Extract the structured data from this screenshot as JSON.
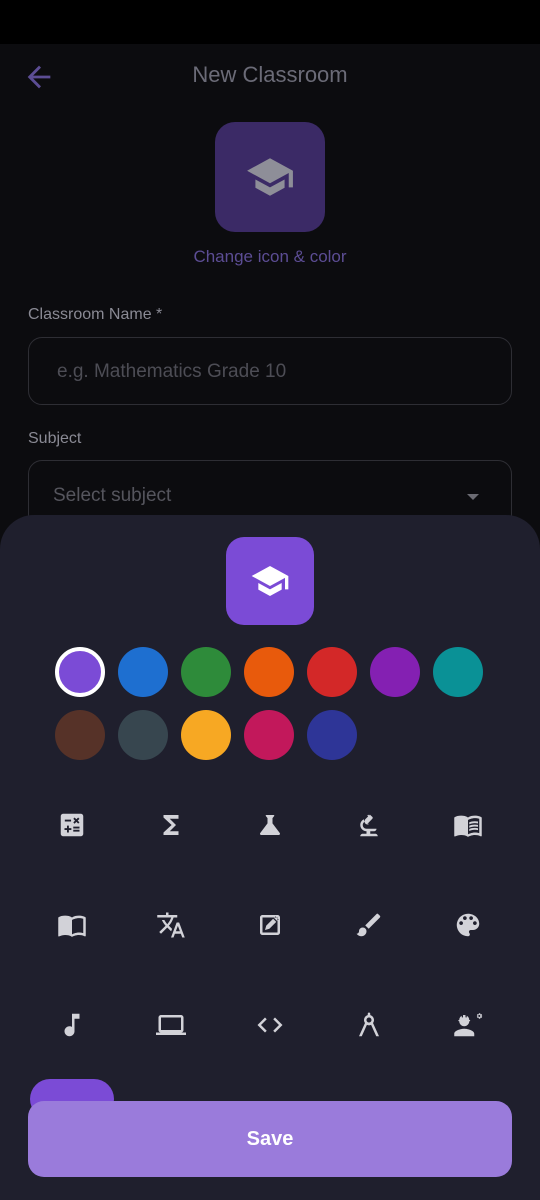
{
  "header": {
    "title": "New Classroom",
    "back_icon": "arrow-back-icon"
  },
  "icon_picker": {
    "change_label": "Change icon & color",
    "current_icon": "graduation-cap-icon"
  },
  "form": {
    "name_label": "Classroom Name *",
    "name_placeholder": "e.g. Mathematics Grade 10",
    "name_value": "",
    "subject_label": "Subject",
    "subject_placeholder": "Select subject"
  },
  "sheet": {
    "selected_color": "#7b4bd6",
    "colors": [
      "#7b4bd6",
      "#1e6fd0",
      "#2e8b3a",
      "#e85a0c",
      "#d32828",
      "#8420b2",
      "#0a9196",
      "#563228",
      "#37464f",
      "#f7a823",
      "#c2185b",
      "#2e3597"
    ],
    "icons": [
      "calculator-icon",
      "sigma-icon",
      "flask-icon",
      "microscope-icon",
      "book-icon",
      "open-book-icon",
      "translate-icon",
      "draw-icon",
      "brush-icon",
      "palette-icon",
      "music-note-icon",
      "laptop-icon",
      "code-icon",
      "compass-icon",
      "engineering-icon"
    ],
    "save_label": "Save"
  }
}
